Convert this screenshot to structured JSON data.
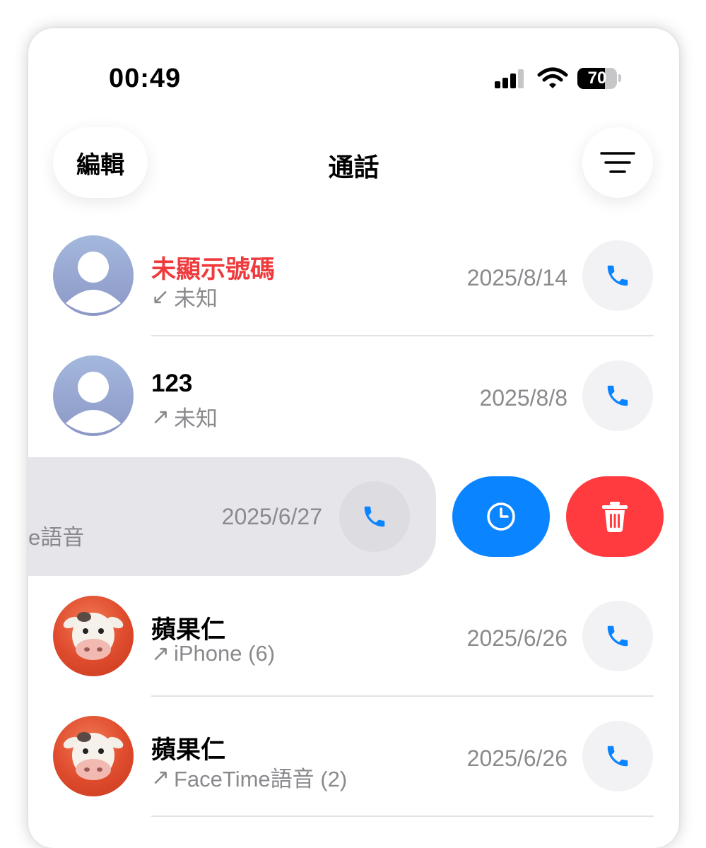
{
  "status_bar": {
    "time": "00:49",
    "battery_level": "70",
    "battery_fraction": 0.7,
    "icons": [
      "cellular-signal-icon",
      "wifi-icon",
      "battery-icon"
    ]
  },
  "header": {
    "edit_label": "編輯",
    "title": "通話",
    "filter_icon": "filter-lines-icon"
  },
  "calls": [
    {
      "name": "未顯示號碼",
      "direction_icon": "↙",
      "detail": "未知",
      "date": "2025/8/14",
      "missed": true,
      "avatar": "generic"
    },
    {
      "name": "123",
      "direction_icon": "↗",
      "detail": "未知",
      "date": "2025/8/8",
      "missed": false,
      "avatar": "generic"
    },
    {
      "name": "",
      "direction_icon": "",
      "detail": "e語音",
      "date": "2025/6/27",
      "missed": false,
      "avatar": "",
      "swiped": true
    },
    {
      "name": "蘋果仁",
      "direction_icon": "↗",
      "detail": "iPhone (6)",
      "date": "2025/6/26",
      "missed": false,
      "avatar": "cow"
    },
    {
      "name": "蘋果仁",
      "direction_icon": "↗",
      "detail": "FaceTime語音 (2)",
      "date": "2025/6/26",
      "missed": false,
      "avatar": "cow"
    }
  ],
  "swipe_actions": {
    "info_icon": "clock-icon",
    "delete_icon": "trash-icon"
  },
  "colors": {
    "accent_blue": "#0a84ff",
    "missed_red": "#ef3a3e",
    "delete_red": "#ff3b3f",
    "secondary_text": "#8a8a8e"
  }
}
